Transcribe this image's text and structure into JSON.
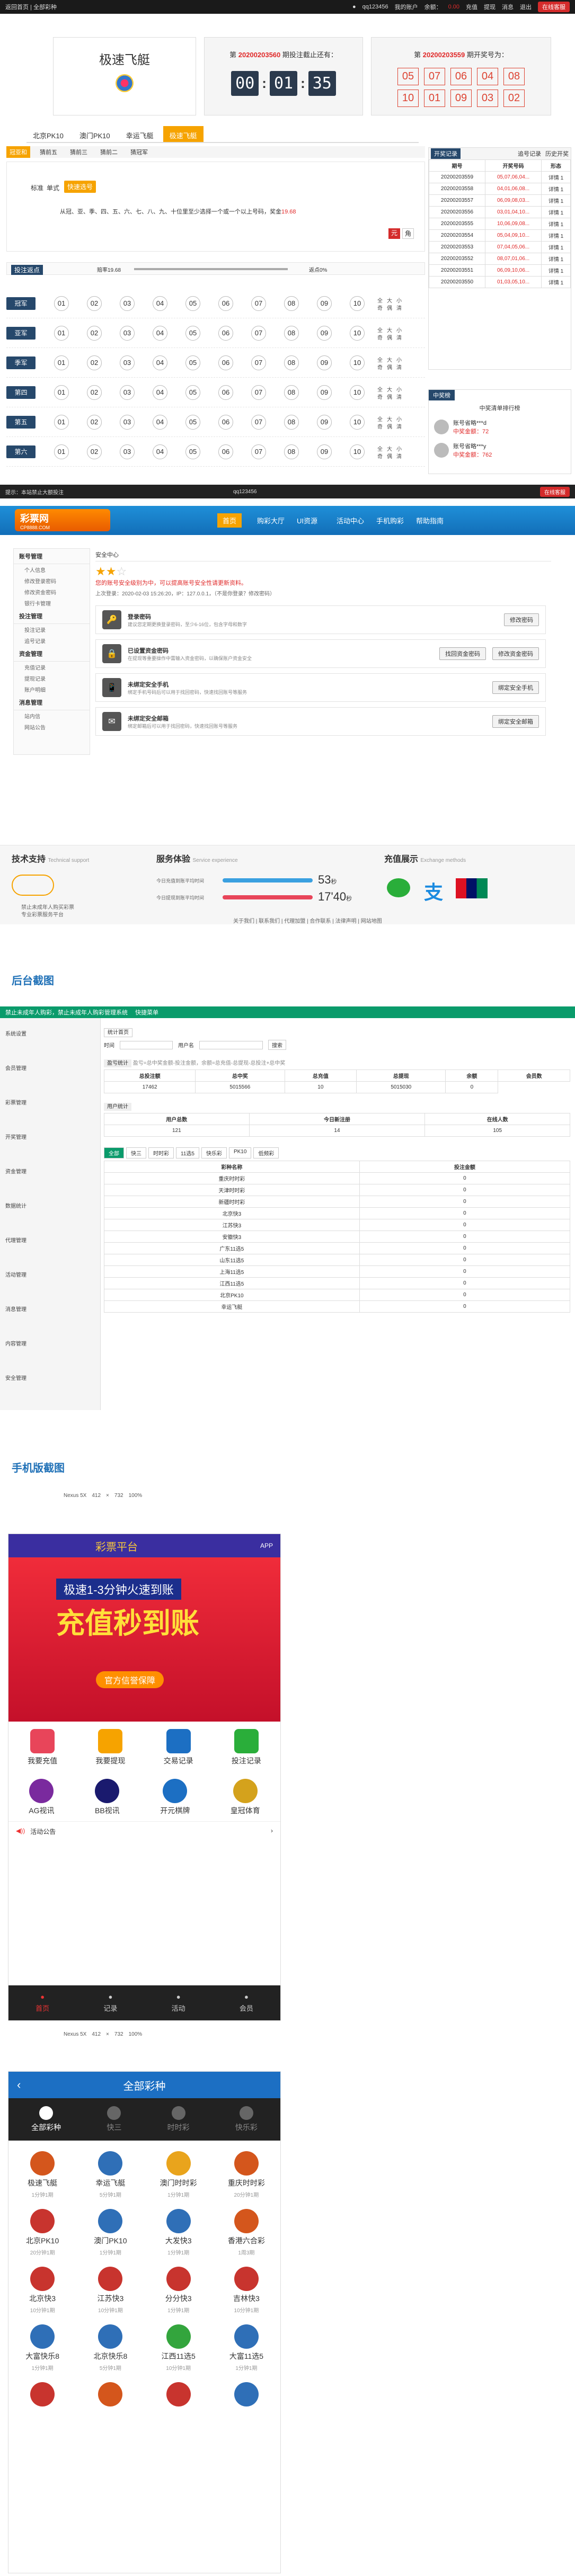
{
  "topbar": {
    "left": "返回首页 | 全部彩种",
    "user": "qq123456",
    "my_account": "我的账户",
    "balance_label": "余额：",
    "balance": "0.00",
    "recharge": "充值",
    "withdraw": "提现",
    "messages": "消息",
    "logout": "退出",
    "online_service": "在线客服"
  },
  "lottery": {
    "name": "极速飞艇",
    "period_label": "第",
    "period": "20200203560",
    "period_suffix": "期投注截止还有：",
    "countdown": [
      "00",
      "01",
      "35"
    ],
    "last_label": "第",
    "last_period": "20200203559",
    "last_suffix": "期开奖号为：",
    "last_numbers": [
      "05",
      "07",
      "06",
      "04",
      "08",
      "10",
      "01",
      "09",
      "03",
      "02"
    ]
  },
  "tabs": [
    "北京PK10",
    "澳门PK10",
    "幸运飞艇",
    "极速飞艇"
  ],
  "subtabs": [
    "冠亚和",
    "猜前五",
    "猜前三",
    "猜前二",
    "猜冠军"
  ],
  "bet_labels": {
    "standard": "标准",
    "single": "单式",
    "quick": "快速选号",
    "hint": "从冠、亚、季、四、五、六、七、八、九、十位里至少选择一个或一个以上号码，奖金",
    "prize": "19.68"
  },
  "rebate": {
    "label": "投注返点",
    "left": "赔率19.68",
    "right": "返点0%"
  },
  "groups": [
    {
      "name": "冠军"
    },
    {
      "name": "亚军"
    },
    {
      "name": "季军"
    },
    {
      "name": "第四"
    },
    {
      "name": "第五"
    },
    {
      "name": "第六"
    }
  ],
  "balls": [
    "01",
    "02",
    "03",
    "04",
    "05",
    "06",
    "07",
    "08",
    "09",
    "10"
  ],
  "quick_pick": [
    "全",
    "大",
    "小",
    "奇",
    "偶",
    "清"
  ],
  "history": {
    "tab1": "开奖记录",
    "tab2": "追号记录",
    "tab3": "历史开奖",
    "header": [
      "期号",
      "开奖号码",
      "形态"
    ],
    "rows": [
      {
        "period": "20200203559",
        "nums": "05,07,06,04...",
        "tail": "详情 1"
      },
      {
        "period": "20200203558",
        "nums": "04,01,06,08...",
        "tail": "详情 1"
      },
      {
        "period": "20200203557",
        "nums": "06,09,08,03...",
        "tail": "详情 1"
      },
      {
        "period": "20200203556",
        "nums": "03,01,04,10...",
        "tail": "详情 1"
      },
      {
        "period": "20200203555",
        "nums": "10,06,09,08...",
        "tail": "详情 1"
      },
      {
        "period": "20200203554",
        "nums": "05,04,09,10...",
        "tail": "详情 1"
      },
      {
        "period": "20200203553",
        "nums": "07,04,05,06...",
        "tail": "详情 1"
      },
      {
        "period": "20200203552",
        "nums": "08,07,01,06...",
        "tail": "详情 1"
      },
      {
        "period": "20200203551",
        "nums": "06,09,10,06...",
        "tail": "详情 1"
      },
      {
        "period": "20200203550",
        "nums": "01,03,05,10...",
        "tail": "详情 1"
      }
    ]
  },
  "winners": {
    "title": "中奖榜",
    "subtitle": "中奖清单排行榜",
    "items": [
      {
        "name": "账号省略***d",
        "amount": "中奖金额：72"
      },
      {
        "name": "账号省略***y",
        "amount": "中奖金额：762"
      }
    ]
  },
  "cart": {
    "btn1": "添加",
    "btn2": "确认投注",
    "notice": "提示：本站禁止大额投注"
  },
  "footer_bar": {
    "text": "欢迎使用 | 设置 | 安全中心 | 帮助中心 | 在线客服"
  },
  "site2": {
    "logo": "彩票网",
    "logo_sub": "CP8888.COM",
    "nav": [
      "首页",
      "购彩大厅",
      "UI资源",
      "活动中心",
      "手机购彩",
      "帮助指南"
    ]
  },
  "user_menu": {
    "title": "账号管理",
    "groups": [
      {
        "head": "账号管理",
        "items": [
          "个人信息",
          "修改登录密码",
          "修改资金密码",
          "银行卡管理"
        ]
      },
      {
        "head": "投注管理",
        "items": [
          "投注记录",
          "追号记录"
        ]
      },
      {
        "head": "资金管理",
        "items": [
          "充值记录",
          "提现记录",
          "账户明细"
        ]
      },
      {
        "head": "消息管理",
        "items": [
          "站内信",
          "网站公告"
        ]
      }
    ]
  },
  "security": {
    "title": "安全中心",
    "level_text": "您的账号安全级别为中，可以提高账号安全性请更新资料。",
    "last_login": "上次登录：2020-02-03 15:26:20，IP：127.0.0.1，（不是你登录？修改密码）",
    "rows": [
      {
        "title": "登录密码",
        "desc": "建议您定期更换登录密码，至少6-16位，包含字母和数字",
        "btn": "修改密码",
        "btn2": ""
      },
      {
        "title": "已设置资金密码",
        "desc": "在提现等重要操作中需输入资金密码，以确保账户资金安全",
        "btn": "找回资金密码",
        "btn2": "修改资金密码"
      },
      {
        "title": "未绑定安全手机",
        "desc": "绑定手机号码后可以用于找回密码，快速找回账号等服务",
        "btn": "绑定安全手机",
        "btn2": ""
      },
      {
        "title": "未绑定安全邮箱",
        "desc": "绑定邮箱后可以用于找回密码，快速找回账号等服务",
        "btn": "绑定安全邮箱",
        "btn2": ""
      }
    ]
  },
  "footer_info": {
    "tech": "技术支持",
    "tech_en": "Technical support",
    "tech_text1": "禁止未成年人购买彩票",
    "tech_text2": "专业彩票服务平台",
    "service": "服务体验",
    "service_en": "Service experience",
    "svc1_label": "今日充值到账平均时间",
    "svc1_val": "53",
    "svc1_unit": "秒",
    "svc2_label": "今日提现到账平均时间",
    "svc2_val": "17'40",
    "svc2_unit": "秒",
    "pay": "充值展示",
    "pay_en": "Exchange methods",
    "links": "关于我们 | 联系我们 | 代理加盟 | 合作联系 | 法律声明 | 网站地图"
  },
  "admin": {
    "section_title": "后台截图",
    "system": "禁止未成年人购彩，禁止未成年人购彩管理系统",
    "quick": "快捷菜单",
    "tab": "统计首页",
    "filter_label": "时间",
    "user_label": "用户名",
    "search": "搜索",
    "box1": "盈亏统计",
    "box1_hint": "盈亏=总中奖金额-投注金额，余额=总充值-总提现-总投注+总中奖",
    "cols1": [
      "总投注额",
      "总中奖",
      "总充值",
      "总提现",
      "余额",
      "会员数"
    ],
    "vals1": [
      "17462",
      "5015566",
      "10",
      "5015030",
      "0"
    ],
    "box2": "用户统计",
    "cols2": [
      "用户总数",
      "今日新注册",
      "在线人数"
    ],
    "vals2": [
      "121",
      "14",
      "105"
    ],
    "gtabs": [
      "全部",
      "快三",
      "时时彩",
      "11选5",
      "快乐彩",
      "PK10",
      "低频彩"
    ],
    "list_head": [
      "彩种名称",
      "投注金额"
    ],
    "list": [
      [
        "重庆时时彩",
        "0"
      ],
      [
        "天津时时彩",
        "0"
      ],
      [
        "新疆时时彩",
        "0"
      ],
      [
        "北京快3",
        "0"
      ],
      [
        "江苏快3",
        "0"
      ],
      [
        "安徽快3",
        "0"
      ],
      [
        "广东11选5",
        "0"
      ],
      [
        "山东11选5",
        "0"
      ],
      [
        "上海11选5",
        "0"
      ],
      [
        "江西11选5",
        "0"
      ],
      [
        "北京PK10",
        "0"
      ],
      [
        "幸运飞艇",
        "0"
      ]
    ],
    "menu": [
      "系统设置",
      "会员管理",
      "彩票管理",
      "开奖管理",
      "资金管理",
      "数据统计",
      "代理管理",
      "活动管理",
      "消息管理",
      "内容管理",
      "安全管理"
    ]
  },
  "mobile": {
    "section_title": "手机版截图",
    "device": "Nexus 5X",
    "w": "412",
    "x": "×",
    "h": "732",
    "zoom": "100%",
    "app_logo": "彩票平台",
    "app_btn": "APP",
    "banner_title": "充值秒到账",
    "banner_sub": "极速1-3分钟火速到账",
    "banner_btn": "官方信誉保障",
    "quick": [
      "我要充值",
      "我要提现",
      "交易记录",
      "投注记录"
    ],
    "games": [
      "AG视讯",
      "BB视讯",
      "开元棋牌",
      "皇冠体育"
    ],
    "marquee": "活动公告",
    "bottom": [
      "首页",
      "记录",
      "活动",
      "会员"
    ],
    "all_title": "全部彩种",
    "all_tabs": [
      "全部彩种",
      "快三",
      "时时彩",
      "快乐彩"
    ],
    "all_items": [
      {
        "name": "极速飞艇",
        "sub": "1分钟1期",
        "c": "#d4561c"
      },
      {
        "name": "幸运飞艇",
        "sub": "5分钟1期",
        "c": "#2f6fb7"
      },
      {
        "name": "澳门时时彩",
        "sub": "1分钟1期",
        "c": "#e9a41c"
      },
      {
        "name": "重庆时时彩",
        "sub": "20分钟1期",
        "c": "#d4561c"
      },
      {
        "name": "北京PK10",
        "sub": "20分钟1期",
        "c": "#c8342e"
      },
      {
        "name": "澳门PK10",
        "sub": "1分钟1期",
        "c": "#2f6fb7"
      },
      {
        "name": "大发快3",
        "sub": "1分钟1期",
        "c": "#2f6fb7"
      },
      {
        "name": "香港六合彩",
        "sub": "1周3期",
        "c": "#d4561c"
      },
      {
        "name": "北京快3",
        "sub": "10分钟1期",
        "c": "#c8342e"
      },
      {
        "name": "江苏快3",
        "sub": "10分钟1期",
        "c": "#c8342e"
      },
      {
        "name": "分分快3",
        "sub": "1分钟1期",
        "c": "#c8342e"
      },
      {
        "name": "吉林快3",
        "sub": "10分钟1期",
        "c": "#c8342e"
      },
      {
        "name": "大富快乐8",
        "sub": "1分钟1期",
        "c": "#2f6fb7"
      },
      {
        "name": "北京快乐8",
        "sub": "5分钟1期",
        "c": "#2f6fb7"
      },
      {
        "name": "江西11选5",
        "sub": "10分钟1期",
        "c": "#33a53d"
      },
      {
        "name": "大富11选5",
        "sub": "1分钟1期",
        "c": "#2f6fb7"
      },
      {
        "name": "",
        "sub": "",
        "c": "#c8342e"
      },
      {
        "name": "",
        "sub": "",
        "c": "#d4561c"
      },
      {
        "name": "",
        "sub": "",
        "c": "#c8342e"
      },
      {
        "name": "",
        "sub": "",
        "c": "#2f6fb7"
      }
    ]
  }
}
